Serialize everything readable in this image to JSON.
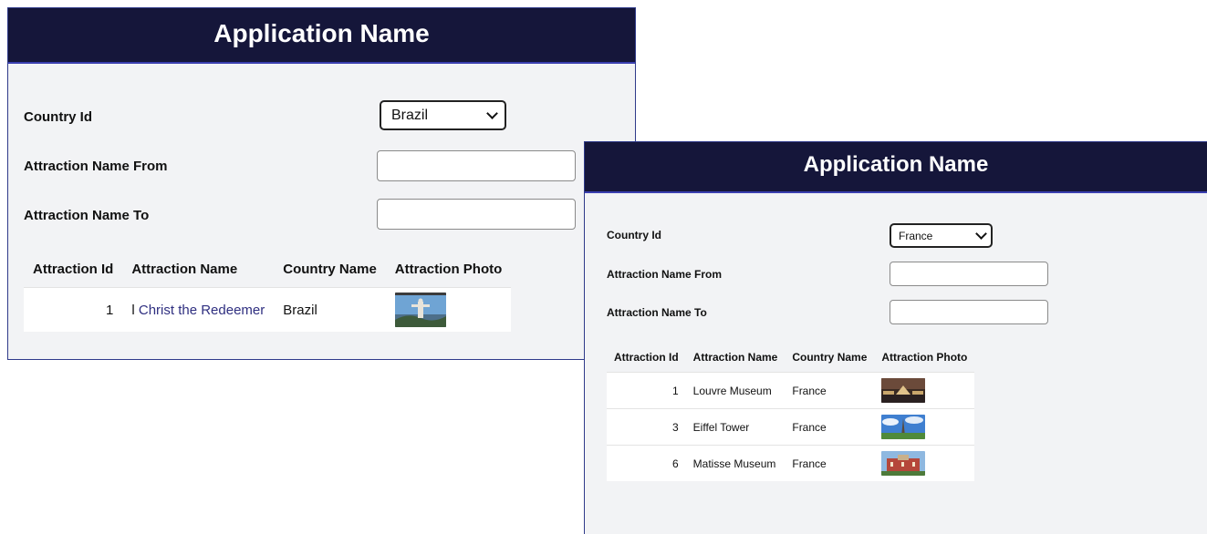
{
  "colors": {
    "header_bg": "#15163a",
    "header_border": "#3a3fb0",
    "panel_bg": "#f2f3f5",
    "link": "#2f2f80"
  },
  "window_a": {
    "title": "Application Name",
    "country_label": "Country Id",
    "country_value": "Brazil",
    "from_label": "Attraction Name From",
    "from_value": "",
    "to_label": "Attraction Name To",
    "to_value": "",
    "columns": [
      "Attraction Id",
      "Attraction Name",
      "Country Name",
      "Attraction Photo"
    ],
    "rows": [
      {
        "id": "1",
        "name_prefix": "l",
        "name": "Christ the Redeemer",
        "country": "Brazil",
        "photo": "christ-redeemer-photo"
      }
    ]
  },
  "window_b": {
    "title": "Application Name",
    "country_label": "Country Id",
    "country_value": "France",
    "from_label": "Attraction Name From",
    "from_value": "",
    "to_label": "Attraction Name To",
    "to_value": "",
    "columns": [
      "Attraction Id",
      "Attraction Name",
      "Country Name",
      "Attraction Photo"
    ],
    "rows": [
      {
        "id": "1",
        "name": "Louvre Museum",
        "country": "France",
        "photo": "louvre-photo"
      },
      {
        "id": "3",
        "name": "Eiffel Tower",
        "country": "France",
        "photo": "eiffel-photo"
      },
      {
        "id": "6",
        "name": "Matisse Museum",
        "country": "France",
        "photo": "matisse-photo"
      }
    ]
  }
}
